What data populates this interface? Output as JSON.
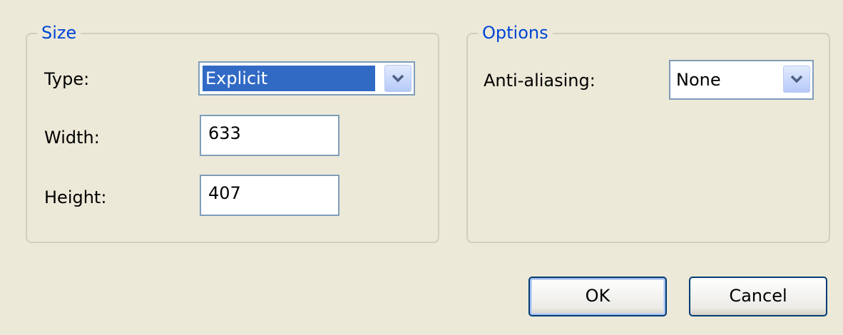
{
  "size": {
    "title": "Size",
    "type_label": "Type:",
    "type_value": "Explicit",
    "width_label": "Width:",
    "width_value": "633",
    "height_label": "Height:",
    "height_value": "407"
  },
  "options": {
    "title": "Options",
    "antialias_label": "Anti-aliasing:",
    "antialias_value": "None"
  },
  "buttons": {
    "ok_label": "OK",
    "cancel_label": "Cancel"
  },
  "icons": {
    "dropdown": "chevron-down-icon"
  },
  "colors": {
    "dialog_background": "#ECE9D8",
    "group_title": "#0046D5",
    "selection": "#316AC5",
    "field_border": "#7F9DB9",
    "button_border": "#003C74"
  }
}
